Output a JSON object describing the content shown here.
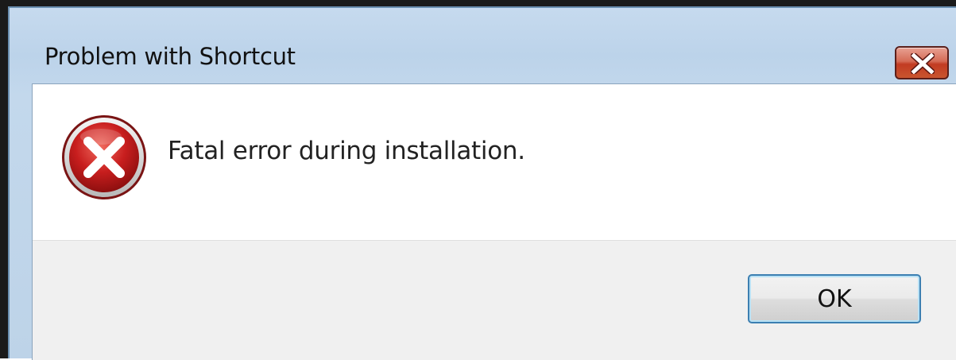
{
  "dialog": {
    "title": "Problem with Shortcut",
    "message": "Fatal error during installation.",
    "ok_label": "OK",
    "icon": "error-icon"
  },
  "colors": {
    "title_bar": "#c3d8ec",
    "close_button": "#c9552f",
    "error_icon_red": "#c81e1e",
    "footer_background": "#f0f0f0",
    "ok_button_border": "#3c7fb1"
  }
}
